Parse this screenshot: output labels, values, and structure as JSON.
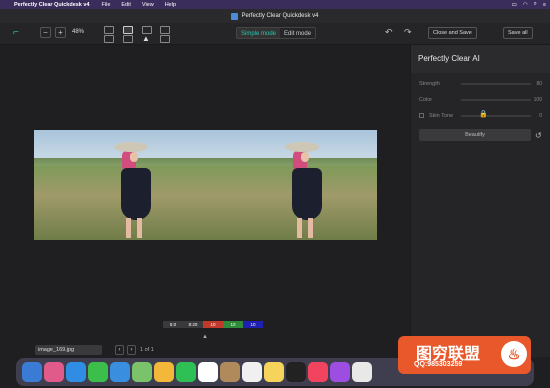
{
  "menubar": {
    "app_name": "Perfectly Clear Quickdesk v4",
    "items": [
      "File",
      "Edit",
      "View",
      "Help"
    ]
  },
  "window": {
    "title": "Perfectly Clear Quickdesk v4"
  },
  "toolbar": {
    "zoom_out": "−",
    "zoom_in": "+",
    "zoom_value": "48%",
    "mode_simple": "Simple mode",
    "mode_edit": "Edit mode",
    "close_and_save": "Close and Save",
    "save_all": "Save all"
  },
  "swatches": [
    {
      "label": "5:0",
      "color": "#3a3a3d"
    },
    {
      "label": "8:20",
      "color": "#3a3a3d"
    },
    {
      "label": "10",
      "color": "#c0392b"
    },
    {
      "label": "10",
      "color": "#2e8b3a"
    },
    {
      "label": "10",
      "color": "#1f1fb0"
    }
  ],
  "bottombar": {
    "file_name": "image_169.jpg",
    "page_text": "1 of 1"
  },
  "panel": {
    "title": "Perfectly Clear AI",
    "strength_label": "Strength",
    "strength_value": "80",
    "color_label": "Color",
    "color_value": "100",
    "skin_label": "Skin Tone",
    "skin_value": "0",
    "beautify_label": "Beautify"
  },
  "watermark": {
    "line1": "图穷联盟",
    "line2": "QQ:985303259"
  },
  "colors": {
    "accent": "#29c7b2",
    "menubar": "#3a2d5c"
  }
}
